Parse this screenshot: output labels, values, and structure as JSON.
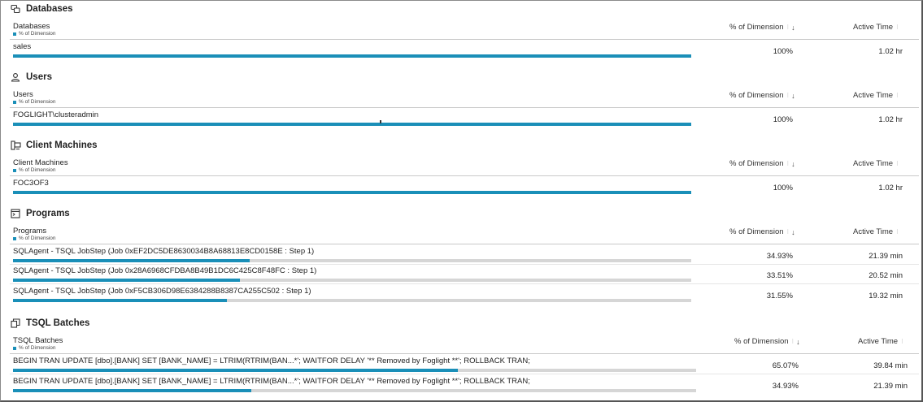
{
  "col_pct_label": "% of Dimension",
  "col_time_label": "Active Time",
  "sub_label": "% of Dimension",
  "colors": {
    "bar": "#1a8fb8",
    "track": "#d6d6d6"
  },
  "sections": [
    {
      "id": "databases",
      "icon": "databases-icon",
      "title": "Databases",
      "col_label": "Databases",
      "rows": [
        {
          "label": "sales",
          "pct": "100%",
          "time": "1.02 hr",
          "fraction": 1.0
        }
      ]
    },
    {
      "id": "users",
      "icon": "user-icon",
      "title": "Users",
      "col_label": "Users",
      "rows": [
        {
          "label": "FOGLIGHT\\clusteradmin",
          "pct": "100%",
          "time": "1.02 hr",
          "fraction": 1.0
        }
      ]
    },
    {
      "id": "client-machines",
      "icon": "client-machines-icon",
      "title": "Client Machines",
      "col_label": "Client Machines",
      "rows": [
        {
          "label": "FOC3OF3",
          "pct": "100%",
          "time": "1.02 hr",
          "fraction": 1.0
        }
      ]
    },
    {
      "id": "programs",
      "icon": "programs-icon",
      "title": "Programs",
      "col_label": "Programs",
      "rows": [
        {
          "label": "SQLAgent - TSQL JobStep (Job 0xEF2DC5DE8630034B8A68813E8CD0158E : Step 1)",
          "pct": "34.93%",
          "time": "21.39 min",
          "fraction": 0.3493
        },
        {
          "label": "SQLAgent - TSQL JobStep (Job 0x28A6968CFDBA8B49B1DC6C425C8F48FC : Step 1)",
          "pct": "33.51%",
          "time": "20.52 min",
          "fraction": 0.3351
        },
        {
          "label": "SQLAgent - TSQL JobStep (Job 0xF5CB306D98E6384288B8387CA255C502 : Step 1)",
          "pct": "31.55%",
          "time": "19.32 min",
          "fraction": 0.3155
        }
      ]
    },
    {
      "id": "tsql-batches",
      "icon": "tsql-batches-icon",
      "title": "TSQL Batches",
      "col_label": "TSQL Batches",
      "rows": [
        {
          "label": "BEGIN TRAN UPDATE [dbo].[BANK] SET [BANK_NAME] = LTRIM(RTRIM(BAN...*'; WAITFOR DELAY '** Removed by Foglight **'; ROLLBACK TRAN;",
          "pct": "65.07%",
          "time": "39.84 min",
          "fraction": 0.6507
        },
        {
          "label": "BEGIN TRAN UPDATE [dbo].[BANK] SET [BANK_NAME] = LTRIM(RTRIM(BAN...*'; WAITFOR DELAY '** Removed by Foglight **'; ROLLBACK TRAN;",
          "pct": "34.93%",
          "time": "21.39 min",
          "fraction": 0.3493
        }
      ]
    }
  ]
}
